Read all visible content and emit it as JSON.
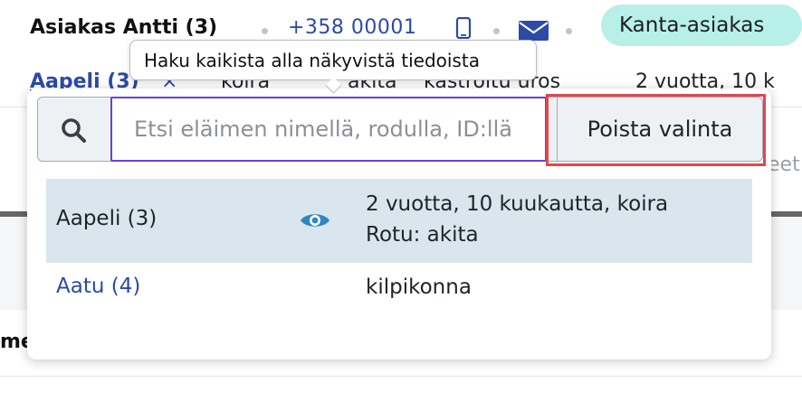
{
  "customer": {
    "name": "Asiakas Antti (3)",
    "phone": "+358 00001",
    "badge": "Kanta-asiakas"
  },
  "pet_summary": {
    "name": "Aapeli (3)",
    "remove": "×",
    "items": [
      "koira",
      "akita",
      "kastroitu uros",
      "2 vuotta, 10 k"
    ]
  },
  "background": {
    "right_clip": "eet",
    "left_clip": "me"
  },
  "tooltip": {
    "text": "Haku kaikista alla näkyvistä tiedoista"
  },
  "search": {
    "placeholder": "Etsi eläimen nimellä, rodulla, ID:llä",
    "clear_label": "Poista valinta"
  },
  "results": [
    {
      "name": "Aapeli (3)",
      "line1": "2 vuotta, 10 kuukautta, koira",
      "line2": "Rotu: akita",
      "selected": true
    },
    {
      "name": "Aatu (4)",
      "line1": "kilpikonna",
      "line2": "",
      "selected": false
    }
  ],
  "colors": {
    "accent": "#2c4aa6",
    "badge_bg": "#b9efe9",
    "selected_row": "#d9e6ee",
    "focus_border": "#6d3fd6",
    "highlight": "#e0484d"
  }
}
